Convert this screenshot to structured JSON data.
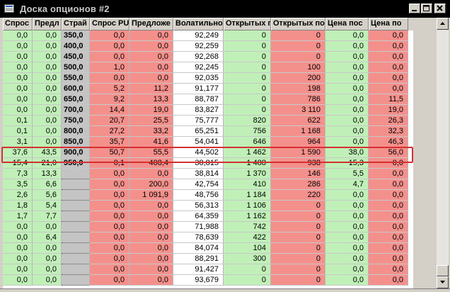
{
  "window": {
    "title": "Доска опционов #2"
  },
  "columns": [
    "Спрос",
    "Предл",
    "Страй",
    "Спрос PU",
    "Предложе",
    "Волатильно",
    "Открытых п",
    "Открытых по",
    "Цена пос",
    "Цена по"
  ],
  "rows": [
    [
      "0,0",
      "0,0",
      "350,0",
      "0,0",
      "0,0",
      "92,249",
      "0",
      "0",
      "0,0",
      "0,0"
    ],
    [
      "0,0",
      "0,0",
      "400,0",
      "0,0",
      "0,0",
      "92,259",
      "0",
      "0",
      "0,0",
      "0,0"
    ],
    [
      "0,0",
      "0,0",
      "450,0",
      "0,0",
      "0,0",
      "92,268",
      "0",
      "0",
      "0,0",
      "0,0"
    ],
    [
      "0,0",
      "0,0",
      "500,0",
      "1,0",
      "0,0",
      "92,245",
      "0",
      "100",
      "0,0",
      "0,0"
    ],
    [
      "0,0",
      "0,0",
      "550,0",
      "0,0",
      "0,0",
      "92,035",
      "0",
      "200",
      "0,0",
      "0,0"
    ],
    [
      "0,0",
      "0,0",
      "600,0",
      "5,2",
      "11,2",
      "91,177",
      "0",
      "198",
      "0,0",
      "0,0"
    ],
    [
      "0,0",
      "0,0",
      "650,0",
      "9,2",
      "13,3",
      "88,787",
      "0",
      "786",
      "0,0",
      "11,5"
    ],
    [
      "0,0",
      "0,0",
      "700,0",
      "14,4",
      "19,0",
      "83,827",
      "0",
      "3 110",
      "0,0",
      "19,0"
    ],
    [
      "0,1",
      "0,0",
      "750,0",
      "20,7",
      "25,5",
      "75,777",
      "820",
      "622",
      "0,0",
      "26,3"
    ],
    [
      "0,1",
      "0,0",
      "800,0",
      "27,2",
      "33,2",
      "65,251",
      "756",
      "1 168",
      "0,0",
      "32,3"
    ],
    [
      "3,1",
      "0,0",
      "850,0",
      "35,7",
      "41,6",
      "54,041",
      "646",
      "964",
      "0,0",
      "46,3"
    ],
    [
      "37,6",
      "43,5",
      "900,0",
      "50,7",
      "55,5",
      "44,502",
      "1 462",
      "1 590",
      "38,0",
      "56,0"
    ],
    [
      "15,4",
      "21,0",
      "950,0",
      "0,1",
      "408,4",
      "38,815",
      "1 488",
      "938",
      "15,3",
      "0,0"
    ],
    [
      "7,3",
      "13,3",
      "",
      "0,0",
      "0,0",
      "38,814",
      "1 370",
      "146",
      "5,5",
      "0,0"
    ],
    [
      "3,5",
      "6,6",
      "",
      "0,0",
      "200,0",
      "42,754",
      "410",
      "286",
      "4,7",
      "0,0"
    ],
    [
      "2,6",
      "5,6",
      "",
      "0,0",
      "1 091,9",
      "48,756",
      "1 184",
      "220",
      "0,0",
      "0,0"
    ],
    [
      "1,8",
      "5,4",
      "",
      "0,0",
      "0,0",
      "56,313",
      "1 106",
      "0",
      "0,0",
      "0,0"
    ],
    [
      "1,7",
      "7,7",
      "",
      "0,0",
      "0,0",
      "64,359",
      "1 162",
      "0",
      "0,0",
      "0,0"
    ],
    [
      "0,0",
      "0,0",
      "",
      "0,0",
      "0,0",
      "71,988",
      "742",
      "0",
      "0,0",
      "0,0"
    ],
    [
      "0,0",
      "6,4",
      "",
      "0,0",
      "0,0",
      "78,639",
      "422",
      "0",
      "0,0",
      "0,0"
    ],
    [
      "0,0",
      "0,0",
      "",
      "0,0",
      "0,0",
      "84,074",
      "104",
      "0",
      "0,0",
      "0,0"
    ],
    [
      "0,0",
      "0,0",
      "",
      "0,0",
      "0,0",
      "88,291",
      "300",
      "0",
      "0,0",
      "0,0"
    ],
    [
      "0,0",
      "0,0",
      "",
      "0,0",
      "0,0",
      "91,427",
      "0",
      "0",
      "0,0",
      "0,0"
    ],
    [
      "0,0",
      "0,0",
      "",
      "0,0",
      "0,0",
      "93,679",
      "0",
      "0",
      "0,0",
      "0,0"
    ]
  ],
  "highlighted_row_index": 11,
  "colors": {
    "call_bg": "#c0f0b8",
    "put_bg": "#f4908c",
    "strike_bg": "#c4c4c4",
    "highlight_border": "#d43030"
  }
}
